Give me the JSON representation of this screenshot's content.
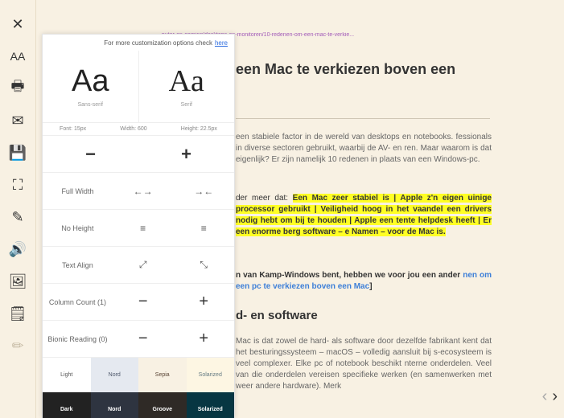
{
  "toolbar": {
    "items": [
      {
        "name": "close-icon",
        "glyph": "✕"
      },
      {
        "name": "font-size-icon",
        "glyph": "AA"
      },
      {
        "name": "print-icon",
        "glyph": "🖶"
      },
      {
        "name": "mail-icon",
        "glyph": "✉"
      },
      {
        "name": "save-icon",
        "glyph": "💾"
      },
      {
        "name": "fullscreen-icon",
        "glyph": "⛶"
      },
      {
        "name": "edit-icon",
        "glyph": "✎"
      },
      {
        "name": "speaker-icon",
        "glyph": "🔊"
      },
      {
        "name": "image-icon",
        "glyph": "🖼"
      },
      {
        "name": "note-icon",
        "glyph": "🗒"
      },
      {
        "name": "pencil-icon",
        "glyph": "✏"
      }
    ]
  },
  "article": {
    "url": "...puter-en-gaming/desktops-en-monitoren/10-redenen-om-een-mac-te-verkie...",
    "title": "een Mac te verkiezen boven een",
    "p1": "een stabiele factor in de wereld van desktops en notebooks. fessionals in diverse sectoren gebruikt, waarbij de AV- en ren. Maar waarom is dat eigenlijk? Er zijn namelijk 10 redenen in plaats van een Windows-pc.",
    "p2_pre": "der meer dat: ",
    "p2_hl": "Een Mac zeer stabiel is | Apple z'n eigen uinige processor gebruikt | Veiligheid hoog in het vaandel een drivers nodig hebt om bij te houden | Apple een tente helpdesk heeft | Er een enorme berg software – e Namen – voor de Mac is.",
    "p3_pre": "n van Kamp-Windows bent, hebben we voor jou een ander",
    "p3_link": "nen om een pc te verkiezen boven een Mac",
    "p3_post": "]",
    "h2": "d- en software",
    "p4": "Mac is dat zowel de hard- als software door dezelfde fabrikant kent dat het besturingssysteem – macOS – volledig aansluit bij s-ecosysteem is veel complexer. Elke pc of notebook beschikt nterne onderdelen. Veel van die onderdelen vereisen specifieke werken (en samenwerken met weer andere hardware). Merk"
  },
  "pager": {
    "prev": "‹",
    "next": "›"
  },
  "panel": {
    "header_text": "For more customization options check",
    "header_link": "here",
    "font_sans_glyph": "Aa",
    "font_sans_name": "Sans-serif",
    "font_serif_glyph": "Aa",
    "font_serif_name": "Serif",
    "metric_font": "Font: 15px",
    "metric_width": "Width: 600",
    "metric_height": "Height: 22.5px",
    "decrease": "−",
    "increase": "+",
    "full_width_label": "Full Width",
    "full_width_expand": "←→",
    "full_width_collapse": "→←",
    "no_height_label": "No Height",
    "no_height_a": "≡",
    "no_height_b": "≡",
    "text_align_label": "Text Align",
    "text_align_a": "⤢",
    "text_align_b": "⤡",
    "column_count_label": "Column Count (1)",
    "column_minus": "−",
    "column_plus": "+",
    "bionic_label": "Bionic Reading (0)",
    "bionic_minus": "−",
    "bionic_plus": "+",
    "themes_light": [
      {
        "label": "Light",
        "bg": "#ffffff",
        "fg": "#555555"
      },
      {
        "label": "Nord",
        "bg": "#e5e9f0",
        "fg": "#4c566a"
      },
      {
        "label": "Sepia",
        "bg": "#f8f1e3",
        "fg": "#5b4636"
      },
      {
        "label": "Solarized",
        "bg": "#fdf6e3",
        "fg": "#657b83"
      }
    ],
    "themes_dark": [
      {
        "label": "Dark",
        "bg": "#222222",
        "fg": "#ffffff"
      },
      {
        "label": "Nord",
        "bg": "#2e3440",
        "fg": "#ffffff"
      },
      {
        "label": "Groove",
        "bg": "#2f2a26",
        "fg": "#ffffff"
      },
      {
        "label": "Solarized",
        "bg": "#073642",
        "fg": "#ffffff"
      }
    ]
  }
}
